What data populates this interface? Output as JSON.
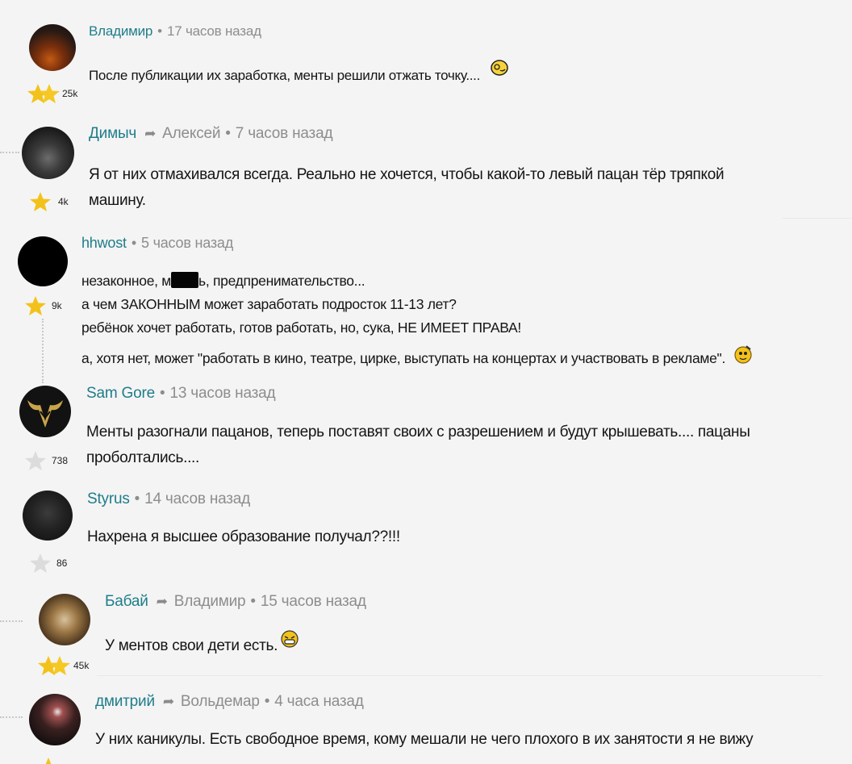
{
  "comments": [
    {
      "author": "Владимир",
      "reply_to": "",
      "time": "17 часов назад",
      "text_lines": [
        "После публикации их заработка, менты решили отжать точку...."
      ],
      "rating": "25k"
    },
    {
      "author": "Димыч",
      "reply_to": "Алексей",
      "time": "7 часов назад",
      "text_lines": [
        "Я от них отмахивался всегда. Реально не хочется, чтобы какой-то левый пацан тёр тряпкой",
        "машину."
      ],
      "rating": "4k"
    },
    {
      "author": "hhwost",
      "reply_to": "",
      "time": "5 часов назад",
      "text_lines": {
        "line1_before": "незаконное, м",
        "line1_after": "ь, предпренимательство...",
        "line2": "а чем ЗАКОННЫМ может заработать подросток 11-13 лет?",
        "line3": "ребёнок хочет работать, готов работать, но, сука, НЕ ИМЕЕТ ПРАВА!",
        "line4": "а, хотя нет, может \"работать в кино, театре, цирке, выступать на концертах и участвовать в рекламе\"."
      },
      "rating": "9k"
    },
    {
      "author": "Sam Gore",
      "reply_to": "",
      "time": "13 часов назад",
      "text_lines": [
        "Менты разогнали пацанов, теперь поставят своих с разрешением и будут крышевать.... пацаны",
        "проболтались...."
      ],
      "rating": "738"
    },
    {
      "author": "Styrus",
      "reply_to": "",
      "time": "14 часов назад",
      "text_lines": [
        "Нахрена я высшее образование получал??!!!"
      ],
      "rating": "86"
    },
    {
      "author": "Бабай",
      "reply_to": "Владимир",
      "time": "15 часов назад",
      "text_lines": [
        "У ментов свои дети есть."
      ],
      "rating": "45k"
    },
    {
      "author": "дмитрий",
      "reply_to": "Вольдемар",
      "time": "4 часа назад",
      "text_lines": [
        "У них каникулы. Есть свободное время, кому мешали не чего плохого в их занятости я не вижу"
      ],
      "rating": ""
    }
  ],
  "colors": {
    "author": "#1f7d8a",
    "meta": "#8d8d8d",
    "star_gold": "#f3c21a",
    "star_grey": "#d9d9d9"
  }
}
